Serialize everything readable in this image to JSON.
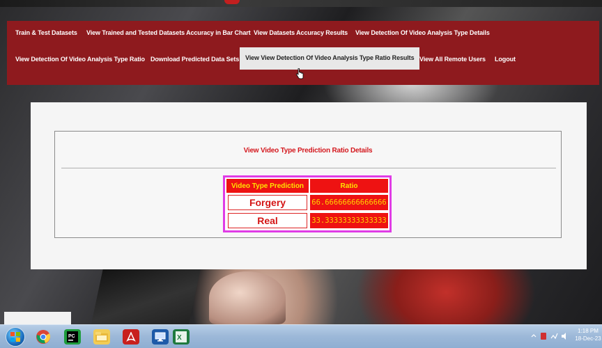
{
  "nav": {
    "row1": [
      "Train & Test Datasets",
      "View Trained and Tested Datasets Accuracy in Bar Chart",
      "View Datasets Accuracy Results",
      "View Detection Of Video Analysis Type Details"
    ],
    "row2": [
      "View Detection Of Video Analysis Type Ratio",
      "Download Predicted Data Sets",
      "View View Detection Of Video Analysis Type Ratio Results",
      "View All Remote Users",
      "Logout"
    ],
    "active": "View View Detection Of Video Analysis Type Ratio Results"
  },
  "main": {
    "heading": "View Video Type Prediction Ratio Details",
    "table": {
      "headers": [
        "Video Type Prediction",
        "Ratio"
      ],
      "rows": [
        {
          "label": "Forgery",
          "ratio": "66.66666666666666"
        },
        {
          "label": "Real",
          "ratio": "33.33333333333333"
        }
      ]
    }
  },
  "taskbar": {
    "icons": [
      "windows-start-icon",
      "chrome-icon",
      "pycharm-icon",
      "file-explorer-icon",
      "acrobat-icon",
      "remote-desktop-icon",
      "excel-icon"
    ],
    "time": "1:18 PM",
    "date": "18-Dec-23"
  },
  "colors": {
    "nav_bg": "#8e1a1e",
    "heading": "#d4181e",
    "table_header_bg": "#ee1212",
    "table_header_text": "#ffe200",
    "table_border": "#e03ce6"
  }
}
